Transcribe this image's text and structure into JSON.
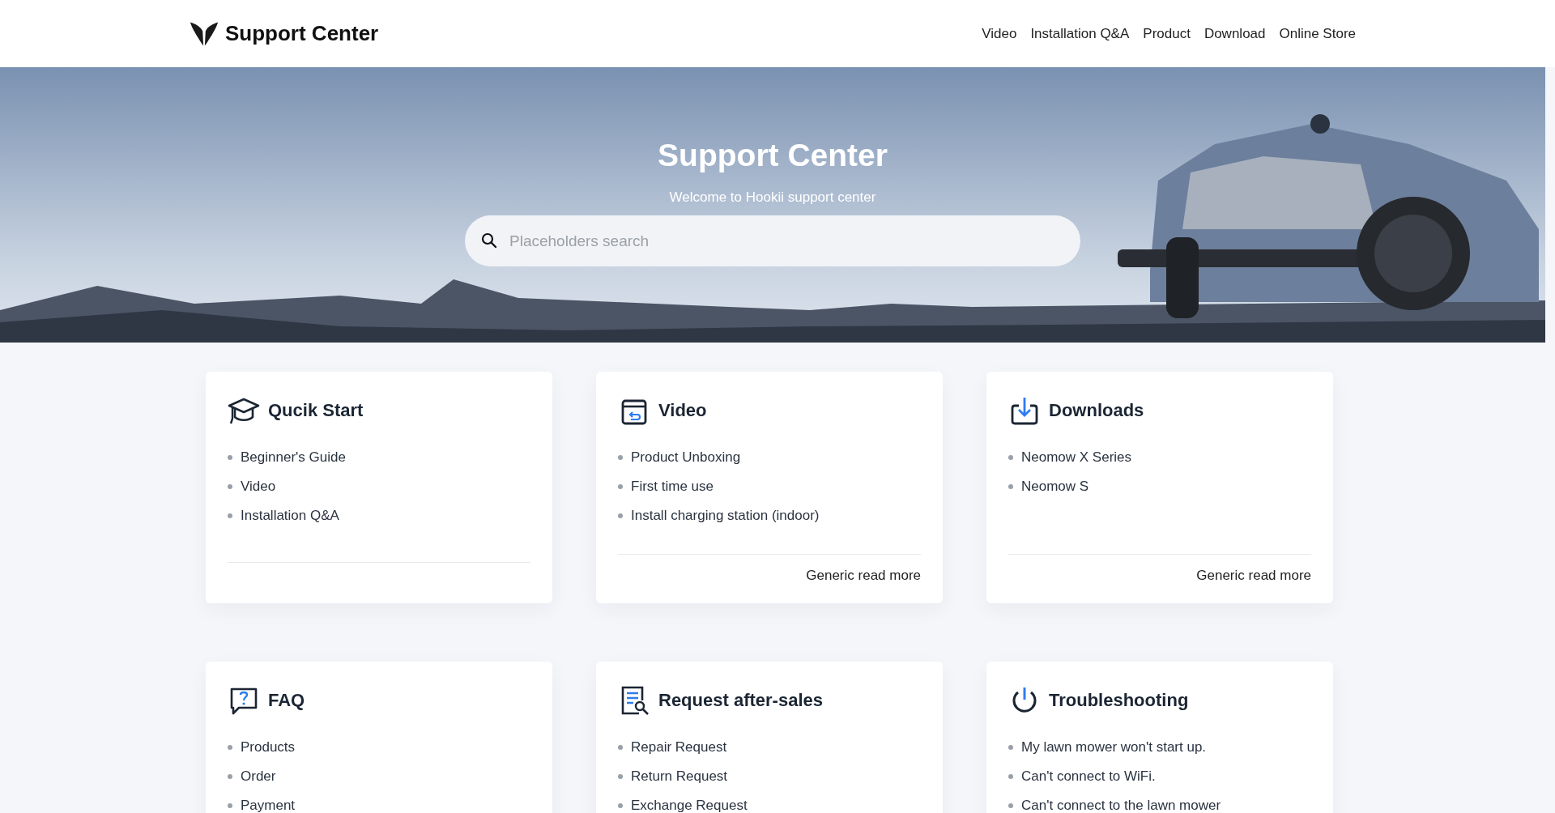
{
  "header": {
    "brand": "Support Center",
    "nav": [
      "Video",
      "Installation Q&A",
      "Product",
      "Download",
      "Online Store"
    ]
  },
  "hero": {
    "kind": "picture",
    "title": "Support Center",
    "subtitle": "Welcome to Hookii support center",
    "search": {
      "placeholder": "Placeholders search"
    }
  },
  "cards": [
    {
      "title": "Qucik Start",
      "items": [
        "Beginner's Guide",
        "Video",
        "Installation Q&A"
      ]
    },
    {
      "title": "Video",
      "items": [
        "Product Unboxing",
        "First time use",
        "Install charging station (indoor)"
      ],
      "read_more": "Generic read more"
    },
    {
      "title": "Downloads",
      "items": [
        "Neomow X Series",
        "Neomow S"
      ],
      "read_more": "Generic read more"
    },
    {
      "title": "FAQ",
      "items": [
        "Products",
        "Order",
        "Payment"
      ]
    },
    {
      "title": "Request after-sales",
      "items": [
        "Repair Request",
        "Return Request",
        "Exchange Request"
      ]
    },
    {
      "title": "Troubleshooting",
      "items": [
        "My lawn mower won't start up.",
        "Can't connect to WiFi.",
        "Can't connect to the lawn mower"
      ]
    }
  ]
}
